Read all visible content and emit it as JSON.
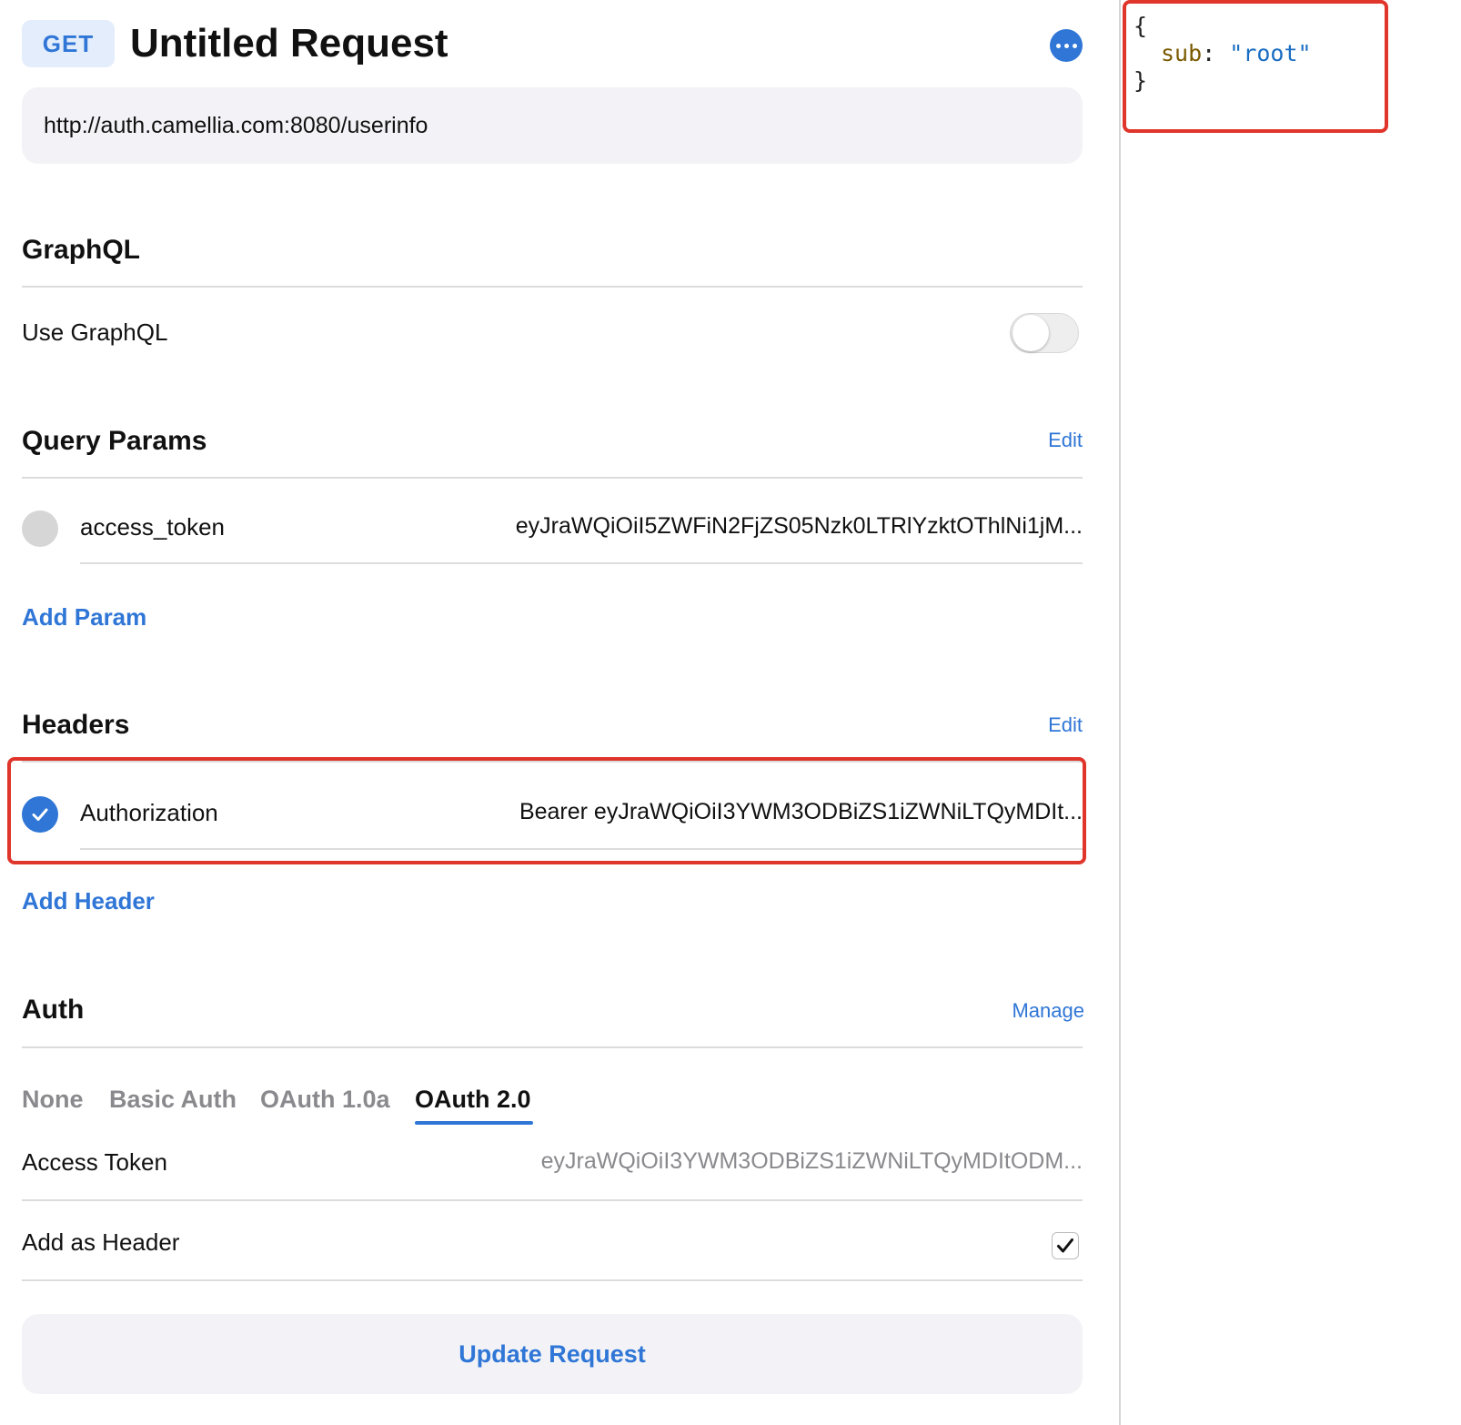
{
  "request": {
    "method": "GET",
    "title": "Untitled Request",
    "url": "http://auth.camellia.com:8080/userinfo"
  },
  "graphql": {
    "section_title": "GraphQL",
    "use_label": "Use GraphQL",
    "enabled": false
  },
  "query_params": {
    "section_title": "Query Params",
    "edit_label": "Edit",
    "items": [
      {
        "name": "access_token",
        "value": "eyJraWQiOiI5ZWFiN2FjZS05Nzk0LTRlYzktOThlNi1jM...",
        "enabled": false
      }
    ],
    "add_label": "Add Param"
  },
  "headers": {
    "section_title": "Headers",
    "edit_label": "Edit",
    "items": [
      {
        "name": "Authorization",
        "value": "Bearer eyJraWQiOiI3YWM3ODBiZS1iZWNiLTQyMDIt...",
        "enabled": true
      }
    ],
    "add_label": "Add Header"
  },
  "auth": {
    "section_title": "Auth",
    "manage_label": "Manage",
    "tabs": [
      "None",
      "Basic Auth",
      "OAuth 1.0a",
      "OAuth 2.0"
    ],
    "active_tab": "OAuth 2.0",
    "access_token_label": "Access Token",
    "access_token_value": "eyJraWQiOiI3YWM3ODBiZS1iZWNiLTQyMDItODM...",
    "add_as_header_label": "Add as Header",
    "add_as_header_checked": true
  },
  "actions": {
    "update_label": "Update Request"
  },
  "response": {
    "open_brace": "{",
    "key": "sub",
    "colon": ":",
    "value": "\"root\"",
    "close_brace": "}"
  },
  "colors": {
    "accent": "#2f76d6",
    "highlight": "#e0352b",
    "badge_bg": "#e3edfb"
  }
}
